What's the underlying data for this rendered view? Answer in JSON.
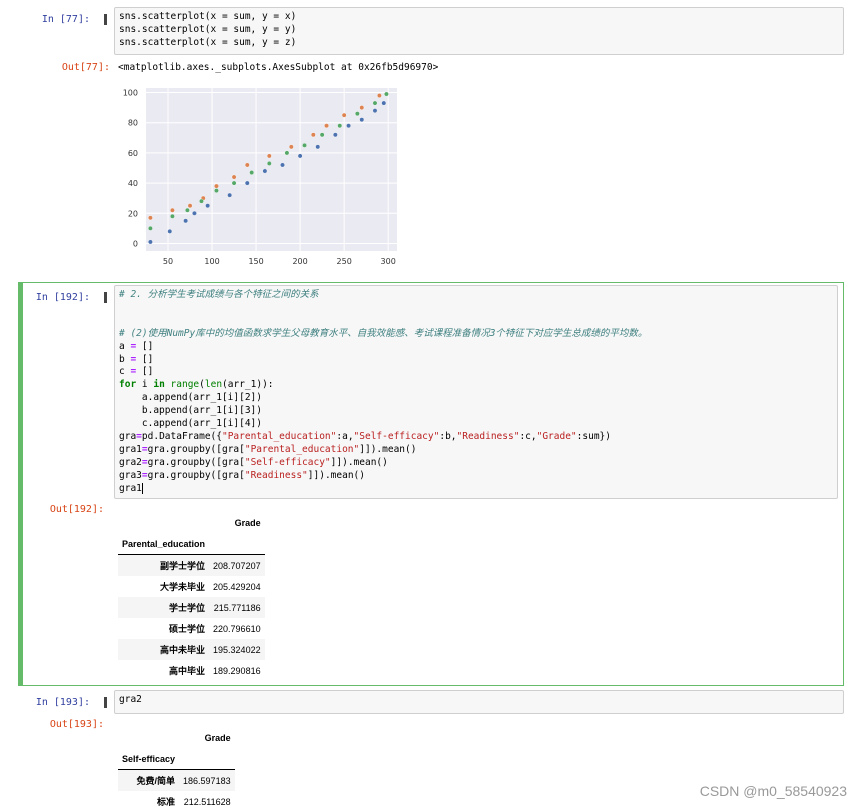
{
  "cell77": {
    "in_prompt": "In  [77]:",
    "code": [
      "sns.scatterplot(x = sum, y = x)",
      "sns.scatterplot(x = sum, y = y)",
      "sns.scatterplot(x = sum, y = z)"
    ],
    "out_prompt": "Out[77]:",
    "out_text": "<matplotlib.axes._subplots.AxesSubplot at 0x26fb5d96970>"
  },
  "chart_data": {
    "type": "scatter",
    "xlim": [
      25,
      310
    ],
    "ylim": [
      -5,
      103
    ],
    "xticks": [
      50,
      100,
      150,
      200,
      250,
      300
    ],
    "yticks": [
      0,
      20,
      40,
      60,
      80,
      100
    ],
    "grid": true,
    "series": [
      {
        "color": "#4c72b0",
        "x": [
          30,
          52,
          70,
          80,
          95,
          120,
          140,
          160,
          180,
          200,
          220,
          240,
          255,
          270,
          285,
          295
        ],
        "values": [
          1,
          8,
          15,
          20,
          25,
          32,
          40,
          48,
          52,
          58,
          64,
          72,
          78,
          82,
          88,
          93
        ]
      },
      {
        "color": "#dd8452",
        "x": [
          30,
          55,
          75,
          90,
          105,
          125,
          140,
          165,
          190,
          215,
          230,
          250,
          270,
          290
        ],
        "values": [
          17,
          22,
          25,
          30,
          38,
          44,
          52,
          58,
          64,
          72,
          78,
          85,
          90,
          98
        ]
      },
      {
        "color": "#55a868",
        "x": [
          30,
          55,
          72,
          88,
          105,
          125,
          145,
          165,
          185,
          205,
          225,
          245,
          265,
          285,
          298
        ],
        "values": [
          10,
          18,
          22,
          28,
          35,
          40,
          47,
          53,
          60,
          65,
          72,
          78,
          86,
          93,
          99
        ]
      }
    ]
  },
  "cell192": {
    "in_prompt": "In  [192]:",
    "comment1": "# 2. 分析学生考试成绩与各个特征之间的关系",
    "comment2": "# (2)使用NumPy库中的均值函数求学生父母教育水平、自我效能感、考试课程准备情况3个特征下对应学生总成绩的平均数。",
    "out_prompt": "Out[192]:",
    "table": {
      "col_header": "Grade",
      "index_name": "Parental_education",
      "rows": [
        {
          "label": "副学士学位",
          "value": "208.707207"
        },
        {
          "label": "大学未毕业",
          "value": "205.429204"
        },
        {
          "label": "学士学位",
          "value": "215.771186"
        },
        {
          "label": "硕士学位",
          "value": "220.796610"
        },
        {
          "label": "高中未毕业",
          "value": "195.324022"
        },
        {
          "label": "高中毕业",
          "value": "189.290816"
        }
      ]
    }
  },
  "cell193": {
    "in_prompt": "In  [193]:",
    "code": "gra2",
    "out_prompt": "Out[193]:",
    "table": {
      "col_header": "Grade",
      "index_name": "Self-efficacy",
      "rows": [
        {
          "label": "免费/简单",
          "value": "186.597183"
        },
        {
          "label": "标准",
          "value": "212.511628"
        }
      ]
    }
  },
  "watermark": "CSDN @m0_58540923"
}
